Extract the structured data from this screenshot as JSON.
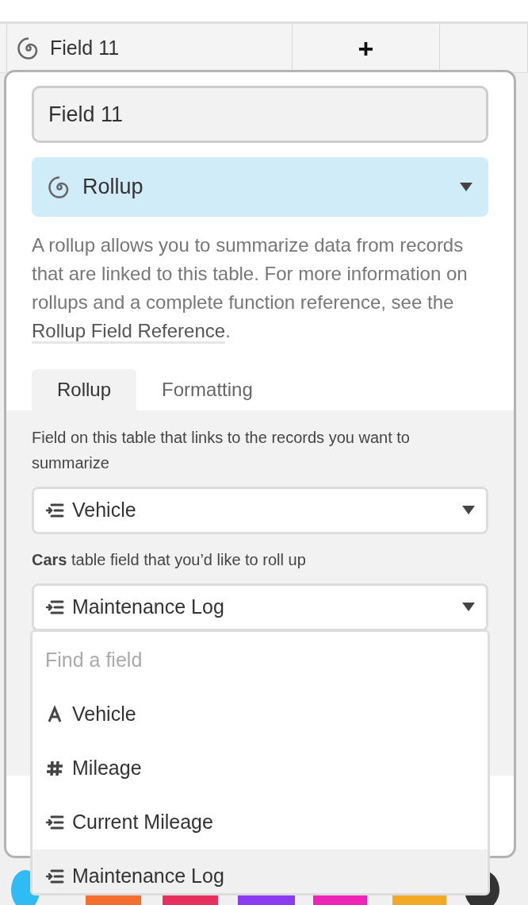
{
  "grid_header": {
    "column": {
      "label": "Field 11",
      "kind": "rollup"
    },
    "add_column": "+"
  },
  "field_editor": {
    "name_value": "Field 11",
    "type_select": {
      "label": "Rollup",
      "kind": "rollup"
    },
    "description": {
      "before": "A rollup allows you to summarize data from records that are linked to this table. For more information on rollups and a complete function reference, see the ",
      "link": "Rollup Field Reference",
      "after": "."
    },
    "tabs": [
      {
        "label": "Rollup",
        "selected": true
      },
      {
        "label": "Formatting",
        "selected": false
      }
    ],
    "link_field_label": "Field on this table that links to the records you want to summarize",
    "link_field_select": {
      "value": "Vehicle",
      "kind": "link"
    },
    "rollup_field_label": "**Cars** table field that you’d like to roll up",
    "rollup_field_select": {
      "value": "Maintenance Log",
      "kind": "link"
    },
    "dropdown": {
      "placeholder": "Find a field",
      "options": [
        {
          "label": "Vehicle",
          "kind": "text",
          "selected": false
        },
        {
          "label": "Mileage",
          "kind": "number",
          "selected": false
        },
        {
          "label": "Current Mileage",
          "kind": "link",
          "selected": false
        },
        {
          "label": "Maintenance Log",
          "kind": "link",
          "selected": true
        }
      ]
    }
  }
}
